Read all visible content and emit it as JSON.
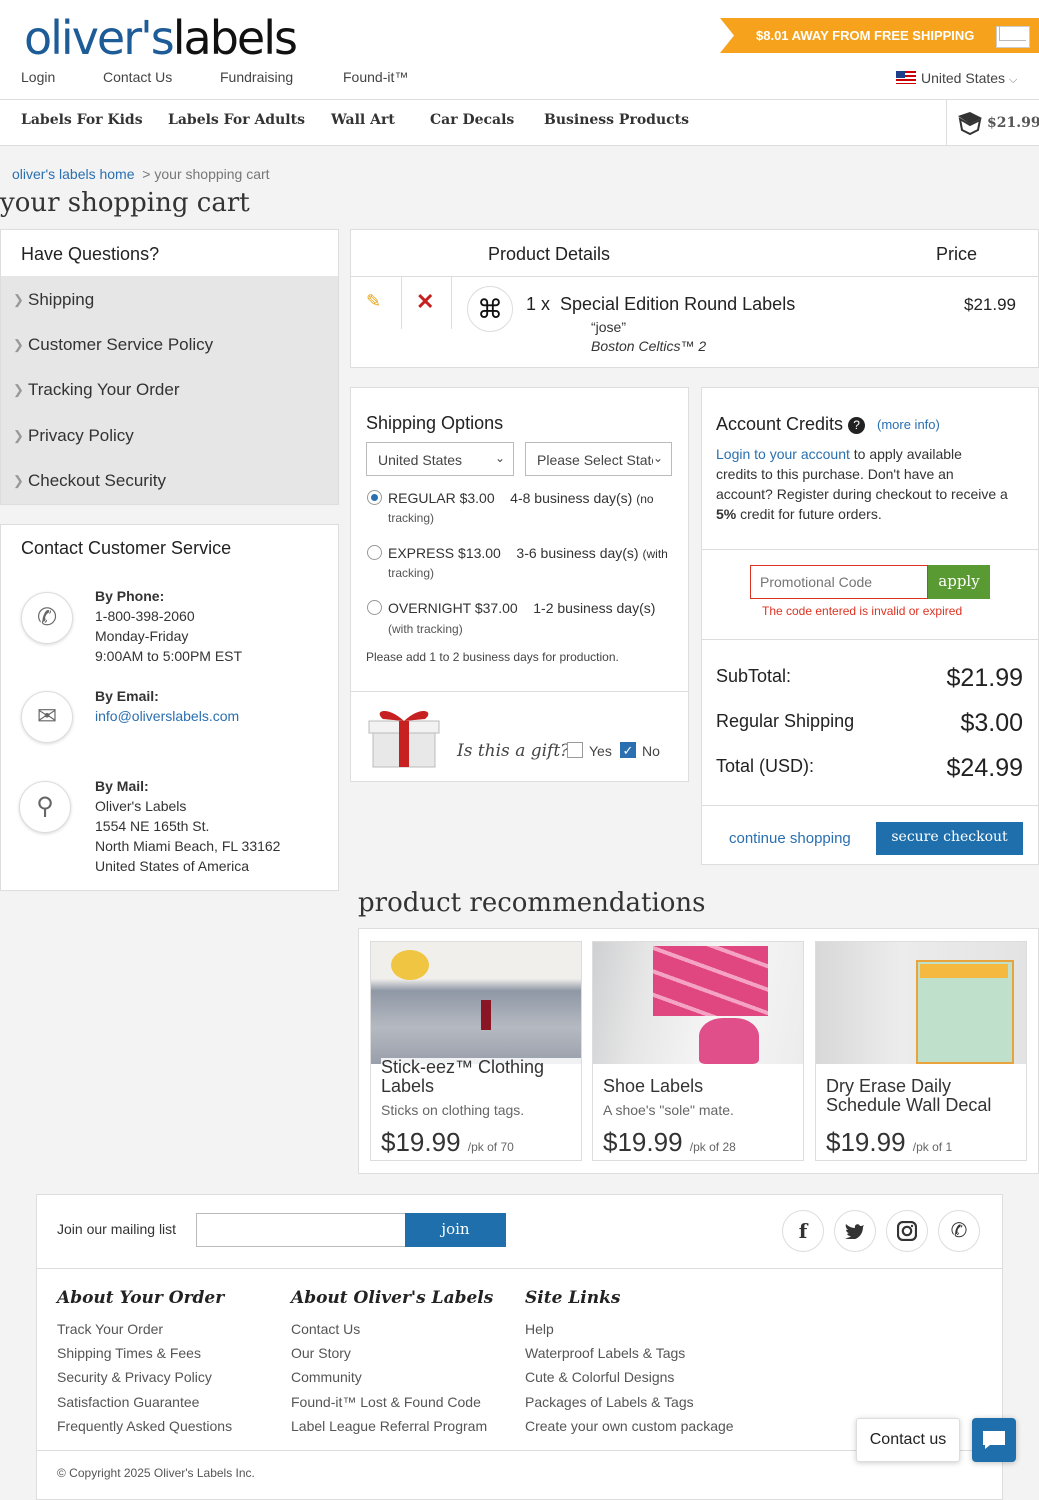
{
  "header": {
    "logo_part1": "oliver's",
    "logo_part2": "labels",
    "links": [
      "Login",
      "Contact Us",
      "Fundraising",
      "Found-it™"
    ],
    "shipping_banner": "$8.01 AWAY FROM FREE SHIPPING",
    "country": "United States"
  },
  "nav": {
    "items": [
      "Labels For Kids",
      "Labels For Adults",
      "Wall Art",
      "Car Decals",
      "Business Products"
    ],
    "cart_total": "$21.99"
  },
  "breadcrumb": {
    "home": "oliver's labels home",
    "sep": ">",
    "current": "your shopping cart"
  },
  "page_title": "your shopping cart",
  "questions": {
    "title": "Have Questions?",
    "items": [
      "Shipping",
      "Customer Service Policy",
      "Tracking Your Order",
      "Privacy Policy",
      "Checkout Security"
    ]
  },
  "contact": {
    "title": "Contact Customer Service",
    "phone_label": "By Phone:",
    "phone": "1-800-398-2060",
    "phone_days": "Monday-Friday",
    "phone_hours": "9:00AM to 5:00PM EST",
    "email_label": "By Email:",
    "email": "info@oliverslabels.com",
    "mail_label": "By Mail:",
    "mail_lines": [
      "Oliver's Labels",
      "1554 NE 165th St.",
      "North Miami Beach, FL 33162",
      "United States of America"
    ]
  },
  "cart": {
    "col_details": "Product Details",
    "col_price": "Price",
    "qty": "1 x",
    "product": "Special Edition Round Labels",
    "line1": "“jose”",
    "line2": "Boston Celtics™ 2",
    "price": "$21.99"
  },
  "shipping": {
    "title": "Shipping Options",
    "country": "United States",
    "state_placeholder": "Please Select State",
    "options": [
      {
        "name": "REGULAR $3.00",
        "days": "4-8 business day(s)",
        "note_a": "(no",
        "note_b": "tracking)"
      },
      {
        "name": "EXPRESS $13.00",
        "days": "3-6 business day(s)",
        "note_a": "(with",
        "note_b": "tracking)"
      },
      {
        "name": "OVERNIGHT $37.00",
        "days": "1-2 business day(s)",
        "note_a": "",
        "note_b": "(with tracking)"
      }
    ],
    "production_note": "Please add 1 to 2 business days for production.",
    "gift_question": "Is this a gift?",
    "gift_yes": "Yes",
    "gift_no": "No"
  },
  "credits": {
    "title": "Account Credits",
    "more_info": "(more info)",
    "login_link": "Login to your account",
    "text1": " to apply available",
    "text2": "credits to this purchase. Don't have an",
    "text3": "account? Register during checkout to receive a",
    "text4_bold": "5%",
    "text4": " credit for future orders.",
    "promo_placeholder": "Promotional Code",
    "apply": "apply",
    "error": "The code entered is invalid or expired"
  },
  "totals": {
    "subtotal_label": "SubTotal:",
    "subtotal": "$21.99",
    "shipping_label": "Regular Shipping",
    "shipping": "$3.00",
    "total_label": "Total (USD):",
    "total": "$24.99",
    "continue": "continue shopping",
    "checkout": "secure checkout"
  },
  "recs": {
    "title": "product recommendations",
    "items": [
      {
        "title1": "Stick-eez™ Clothing",
        "title2": "Labels",
        "sub": "Sticks on clothing tags.",
        "price": "$19.99",
        "unit": "/pk of 70"
      },
      {
        "title1": "Shoe Labels",
        "title2": "",
        "sub": "A shoe's \"sole\" mate.",
        "price": "$19.99",
        "unit": "/pk of 28"
      },
      {
        "title1": "Dry Erase Daily",
        "title2": "Schedule Wall Decal",
        "sub": "",
        "price": "$19.99",
        "unit": "/pk of 1"
      }
    ]
  },
  "footer": {
    "mailing_label": "Join our mailing list",
    "join": "join",
    "cols": [
      {
        "title": "About Your Order",
        "links": [
          "Track Your Order",
          "Shipping Times & Fees",
          "Security & Privacy Policy",
          "Satisfaction Guarantee",
          "Frequently Asked Questions"
        ]
      },
      {
        "title": "About Oliver's Labels",
        "links": [
          "Contact Us",
          "Our Story",
          "Community",
          "Found-it™ Lost & Found Code",
          "Label League Referral Program"
        ]
      },
      {
        "title": "Site Links",
        "links": [
          "Help",
          "Waterproof Labels & Tags",
          "Cute & Colorful Designs",
          "Packages of Labels & Tags",
          "Create your own custom package"
        ]
      }
    ],
    "copyright": "© Copyright 2025 Oliver's Labels Inc.",
    "contact_us": "Contact us"
  }
}
